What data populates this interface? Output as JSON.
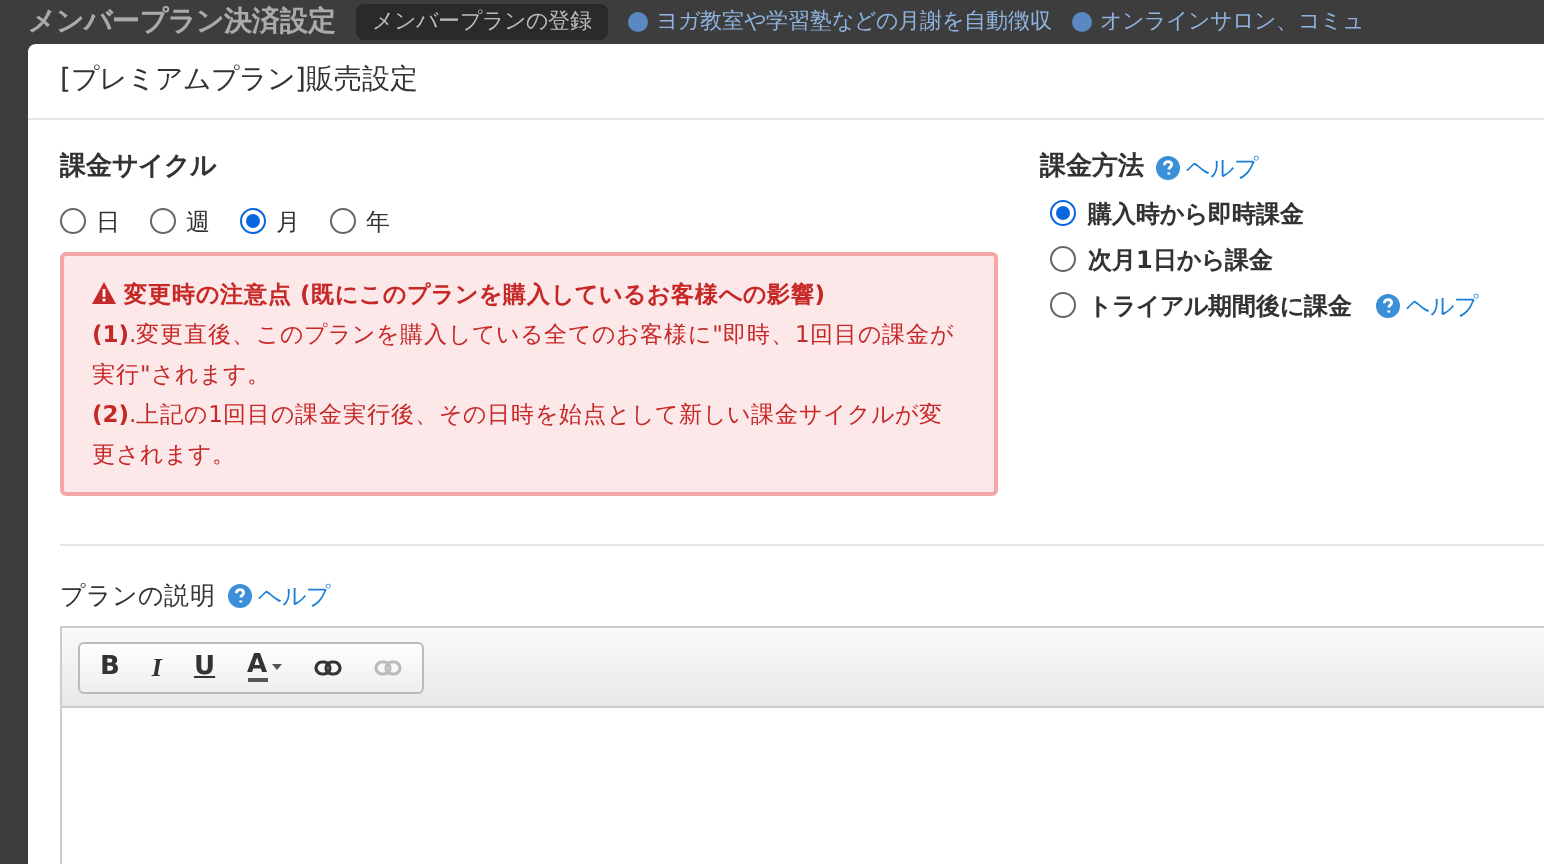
{
  "background_page": {
    "title": "メンバープラン決済設定",
    "register_button": "メンバープランの登録",
    "links": [
      "ヨガ教室や学習塾などの月謝を自動徴収",
      "オンラインサロン、コミュ"
    ]
  },
  "modal": {
    "title": "[プレミアムプラン]販売設定"
  },
  "billing_cycle": {
    "label": "課金サイクル",
    "options": [
      {
        "label": "日",
        "selected": false
      },
      {
        "label": "週",
        "selected": false
      },
      {
        "label": "月",
        "selected": true
      },
      {
        "label": "年",
        "selected": false
      }
    ],
    "warning": {
      "heading": "変更時の注意点 (既にこのプランを購入しているお客様への影響)",
      "lines": [
        "**(1)**.変更直後、このプランを購入している全てのお客様に\"即時、1回目の課金が実行\"されます。",
        "**(2)**.上記の1回目の課金実行後、その日時を始点として新しい課金サイクルが変更されます。"
      ]
    }
  },
  "billing_method": {
    "label": "課金方法",
    "help": "ヘルプ",
    "options": [
      {
        "label": "購入時から即時課金",
        "selected": true
      },
      {
        "label": "次月1日から課金",
        "selected": false
      },
      {
        "label": "トライアル期間後に課金",
        "selected": false,
        "help": "ヘルプ"
      }
    ]
  },
  "description": {
    "label": "プランの説明",
    "help": "ヘルプ",
    "toolbar": [
      {
        "kind": "bold",
        "label": "B",
        "disabled": false
      },
      {
        "kind": "italic",
        "label": "I",
        "disabled": false
      },
      {
        "kind": "underline",
        "label": "U",
        "disabled": false
      },
      {
        "kind": "color",
        "label": "A",
        "disabled": false
      },
      {
        "kind": "link",
        "disabled": false
      },
      {
        "kind": "unlink",
        "disabled": true
      }
    ]
  }
}
